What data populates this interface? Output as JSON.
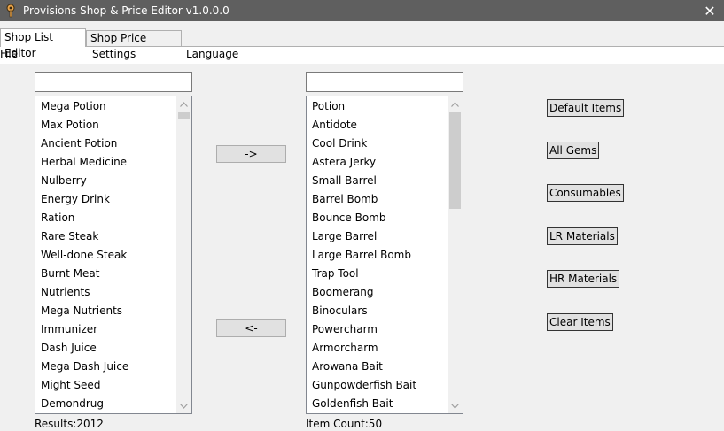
{
  "window": {
    "title": "Provisions Shop & Price Editor v1.0.0.0",
    "close_symbol": "✕"
  },
  "tabs": [
    {
      "label": "Shop List Editor",
      "active": true
    },
    {
      "label": "Shop Price Editor",
      "active": false
    }
  ],
  "menu": {
    "file": "File",
    "settings": "Settings",
    "language": "Language"
  },
  "left_panel": {
    "search_value": "",
    "items": [
      "Mega Potion",
      "Max Potion",
      "Ancient Potion",
      "Herbal Medicine",
      "Nulberry",
      "Energy Drink",
      "Ration",
      "Rare Steak",
      "Well-done Steak",
      "Burnt Meat",
      "Nutrients",
      "Mega Nutrients",
      "Immunizer",
      "Dash Juice",
      "Mega Dash Juice",
      "Might Seed",
      "Demondrug"
    ],
    "status": "Results:2012"
  },
  "transfer": {
    "add_label": "->",
    "remove_label": "<-"
  },
  "right_panel": {
    "search_value": "",
    "items": [
      "Potion",
      "Antidote",
      "Cool Drink",
      "Astera Jerky",
      "Small Barrel",
      "Barrel Bomb",
      "Bounce Bomb",
      "Large Barrel",
      "Large Barrel Bomb",
      "Trap Tool",
      "Boomerang",
      "Binoculars",
      "Powercharm",
      "Armorcharm",
      "Arowana Bait",
      "Gunpowderfish Bait",
      "Goldenfish Bait"
    ],
    "status": "Item Count:50"
  },
  "presets": {
    "default_items": "Default Items",
    "all_gems": "All Gems",
    "consumables": "Consumables",
    "lr_materials": "LR Materials",
    "hr_materials": "HR Materials",
    "clear_items": "Clear Items"
  },
  "icons": {
    "app": "provisions-app-icon",
    "close": "close-icon",
    "scroll_up": "chevron-up-icon",
    "scroll_down": "chevron-down-icon"
  },
  "colors": {
    "titlebar": "#5f5f5f",
    "window_bg": "#f0f0f0",
    "button_bg": "#e1e1e1",
    "scroll_thumb": "#cdcdcd"
  }
}
